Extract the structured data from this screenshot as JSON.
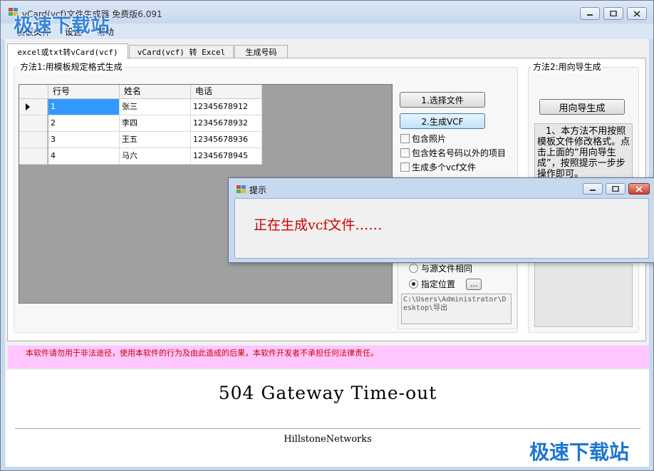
{
  "window": {
    "title": "vCard(vcf)文件生成器 免费版6.091",
    "minimize_icon": "minimize-icon",
    "maximize_icon": "maximize-icon",
    "close_icon": "close-icon"
  },
  "menu": [
    "模板文件",
    "设置",
    "帮助"
  ],
  "tabs": [
    "excel或txt转vCard(vcf)",
    "vCard(vcf) 转 Excel",
    "生成号码"
  ],
  "method1": {
    "title": "方法1:用模板规定格式生成",
    "grid": {
      "columns": [
        "行号",
        "姓名",
        "电话"
      ],
      "rows": [
        [
          "1",
          "张三",
          "12345678912"
        ],
        [
          "2",
          "李四",
          "12345678932"
        ],
        [
          "3",
          "王五",
          "12345678936"
        ],
        [
          "4",
          "马六",
          "12345678945"
        ]
      ]
    },
    "choose_file_button": "1.选择文件",
    "generate_button": "2.生成VCF",
    "options": [
      "包含照片",
      "包含姓名号码以外的项目",
      "生成多个vcf文件"
    ],
    "save_options": [
      "与源文件相同",
      "指定位置"
    ],
    "browse_button": "…",
    "output_path": "C:\\Users\\Administrator\\Desktop\\导出"
  },
  "method2": {
    "title": "方法2:用向导生成",
    "wizard_button": "用向导生成",
    "note": "1、本方法不用按照模板文件修改格式。点击上面的“用向导生成”，按照提示一步步操作即可。"
  },
  "dialog": {
    "title": "提示",
    "message": "正在生成vcf文件……"
  },
  "warning": "本软件请勿用于非法途径，使用本软件的行为及由此造成的后果，本软件开发者不承担任何法律责任。",
  "browser": {
    "error": "504 Gateway Time-out",
    "footer": "HillstoneNetworks"
  },
  "watermark": "极速下载站",
  "colors": {
    "selection": "#3399ff",
    "warning_bg": "#ffc6ff",
    "warning_text": "#cc0000",
    "dialog_text": "#cc0000",
    "watermark": "#1d76d2"
  }
}
